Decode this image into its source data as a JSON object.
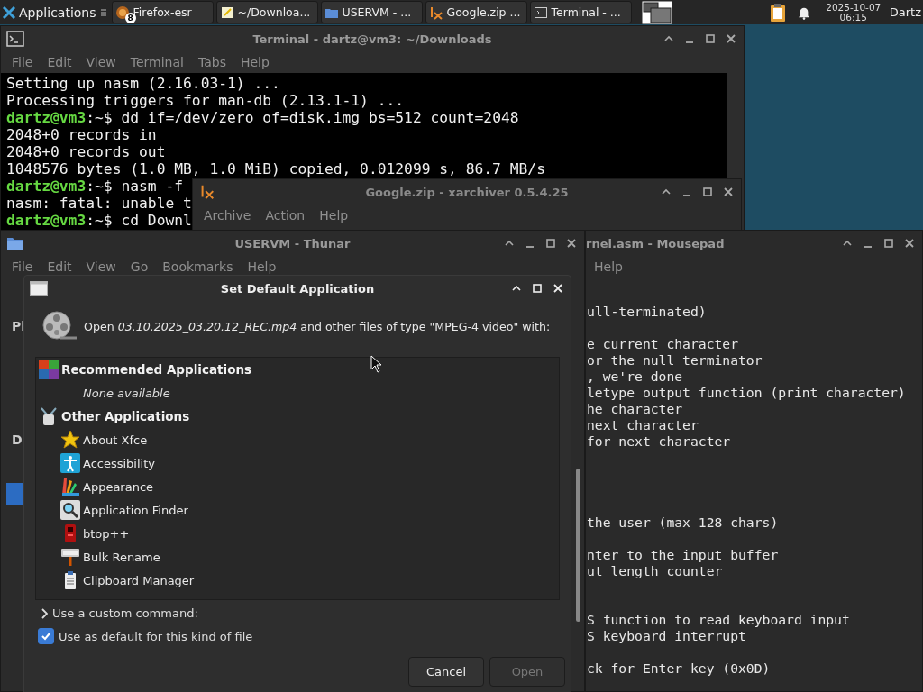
{
  "taskbar": {
    "menu_label": "Applications",
    "tasks": [
      {
        "label": "Firefox-esr",
        "badge": "8"
      },
      {
        "label": "~/Downloa..."
      },
      {
        "label": "USERVM - ..."
      },
      {
        "label": "Google.zip ..."
      },
      {
        "label": "Terminal - ..."
      }
    ],
    "date": "2025-10-07",
    "time": "06:15",
    "user": "Dartz"
  },
  "terminal": {
    "title": "Terminal - dartz@vm3: ~/Downloads",
    "menu": [
      "File",
      "Edit",
      "View",
      "Terminal",
      "Tabs",
      "Help"
    ],
    "lines": [
      {
        "kind": "output",
        "text": "Setting up nasm (2.16.03-1) ..."
      },
      {
        "kind": "output",
        "text": "Processing triggers for man-db (2.13.1-1) ..."
      },
      {
        "kind": "prompt",
        "prompt": "dartz@vm3",
        "text": ":~$ dd if=/dev/zero of=disk.img bs=512 count=2048"
      },
      {
        "kind": "output",
        "text": "2048+0 records in"
      },
      {
        "kind": "output",
        "text": "2048+0 records out"
      },
      {
        "kind": "output",
        "text": "1048576 bytes (1.0 MB, 1.0 MiB) copied, 0.012099 s, 86.7 MB/s"
      },
      {
        "kind": "prompt",
        "prompt": "dartz@vm3",
        "text": ":~$ nasm -f"
      },
      {
        "kind": "output",
        "text": "nasm: fatal: unable t"
      },
      {
        "kind": "prompt",
        "prompt": "dartz@vm3",
        "text": ":~$ cd Downl"
      }
    ]
  },
  "xarchiver": {
    "title": "Google.zip - xarchiver 0.5.4.25",
    "menu": [
      "Archive",
      "Action",
      "Help"
    ]
  },
  "mousepad": {
    "title": "rnel.asm - Mousepad",
    "menu": [
      "Help"
    ],
    "lines": [
      {
        "kind": "text",
        "text": "ull-terminated)"
      },
      {
        "kind": "blank"
      },
      {
        "kind": "text",
        "text": "e current character"
      },
      {
        "kind": "text",
        "text": "or the null terminator"
      },
      {
        "kind": "text",
        "text": ", we're done"
      },
      {
        "kind": "text",
        "text": "letype output function (print character)"
      },
      {
        "kind": "text",
        "text": "he character"
      },
      {
        "kind": "text",
        "text": "next character"
      },
      {
        "kind": "text",
        "text": "for next character"
      },
      {
        "kind": "blank"
      },
      {
        "kind": "blank"
      },
      {
        "kind": "blank"
      },
      {
        "kind": "blank"
      },
      {
        "kind": "text",
        "text": "the user (max 128 chars)"
      },
      {
        "kind": "blank"
      },
      {
        "kind": "text",
        "text": "nter to the input buffer"
      },
      {
        "kind": "text",
        "text": "ut length counter"
      },
      {
        "kind": "blank"
      },
      {
        "kind": "blank"
      },
      {
        "kind": "text",
        "text": "S function to read keyboard input"
      },
      {
        "kind": "text",
        "text": "S keyboard interrupt"
      },
      {
        "kind": "blank"
      },
      {
        "kind": "text",
        "text": "ck for Enter key (0x0D)"
      }
    ]
  },
  "thunar": {
    "title": "USERVM - Thunar",
    "menu": [
      "File",
      "Edit",
      "View",
      "Go",
      "Bookmarks",
      "Help"
    ],
    "sidebar_fragments": [
      "Pl",
      "D"
    ]
  },
  "dialog": {
    "title": "Set Default Application",
    "prompt": "Open *03.10.2025_03.20.12_REC.mp4* and other files of type \"MPEG-4 video\" with:",
    "sections": [
      {
        "label": "Recommended Applications",
        "empty_label": "None available"
      },
      {
        "label": "Other Applications",
        "apps": [
          "About Xfce",
          "Accessibility",
          "Appearance",
          "Application Finder",
          "btop++",
          "Bulk Rename",
          "Clipboard Manager"
        ]
      }
    ],
    "custom_command": {
      "label": "Use a custom command:",
      "expanded": false
    },
    "use_default": {
      "label": "Use as default for this kind of file",
      "checked": true
    },
    "buttons": [
      {
        "label": "Cancel",
        "disabled": false
      },
      {
        "label": "Open",
        "disabled": true
      }
    ]
  }
}
